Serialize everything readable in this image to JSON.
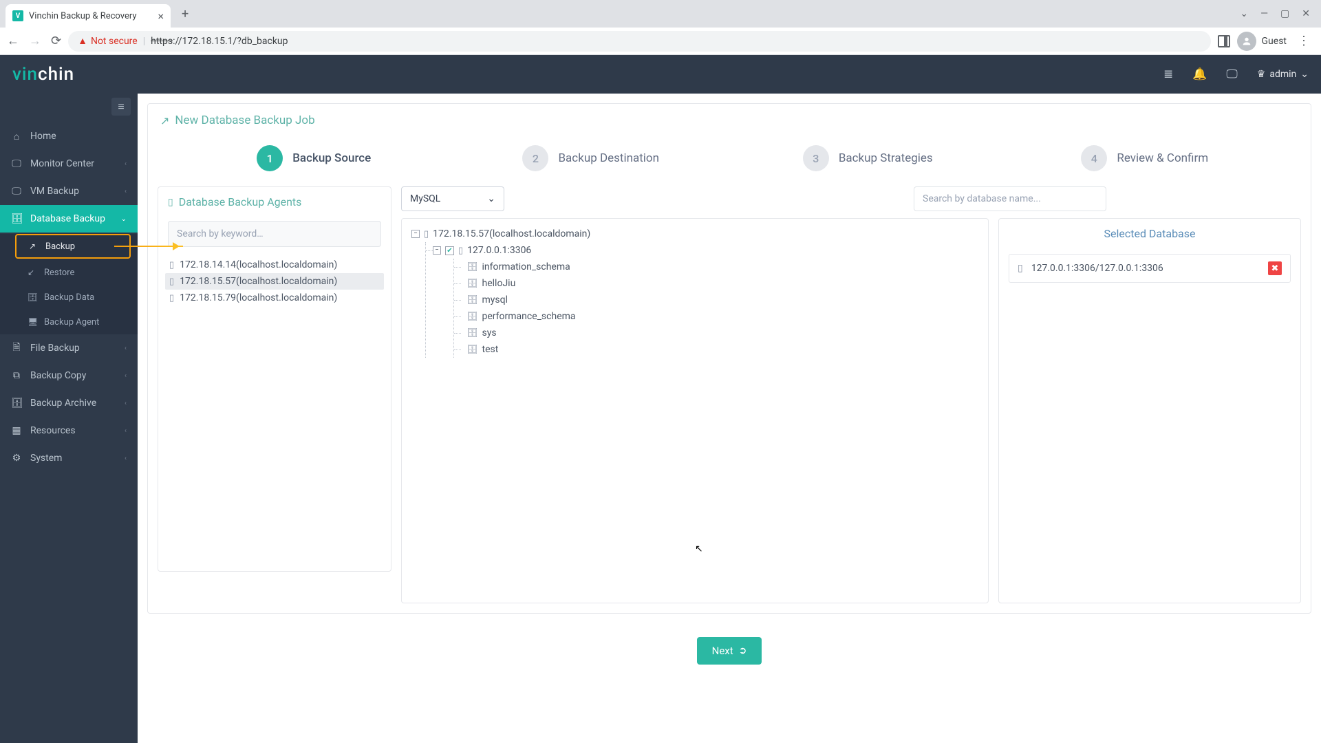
{
  "browser": {
    "tab_title": "Vinchin Backup & Recovery",
    "not_secure": "Not secure",
    "url_proto": "https",
    "url_rest": "://172.18.15.1/?db_backup",
    "guest": "Guest"
  },
  "header": {
    "user": "admin"
  },
  "sidebar": {
    "items": [
      {
        "label": "Home"
      },
      {
        "label": "Monitor Center"
      },
      {
        "label": "VM Backup"
      },
      {
        "label": "Database Backup"
      },
      {
        "label": "File Backup"
      },
      {
        "label": "Backup Copy"
      },
      {
        "label": "Backup Archive"
      },
      {
        "label": "Resources"
      },
      {
        "label": "System"
      }
    ],
    "submenu": [
      {
        "label": "Backup"
      },
      {
        "label": "Restore"
      },
      {
        "label": "Backup Data"
      },
      {
        "label": "Backup Agent"
      }
    ]
  },
  "page": {
    "title": "New Database Backup Job"
  },
  "steps": [
    {
      "num": "1",
      "label": "Backup Source"
    },
    {
      "num": "2",
      "label": "Backup Destination"
    },
    {
      "num": "3",
      "label": "Backup Strategies"
    },
    {
      "num": "4",
      "label": "Review & Confirm"
    }
  ],
  "agents": {
    "header": "Database Backup Agents",
    "search_placeholder": "Search by keyword…",
    "list": [
      "172.18.14.14(localhost.localdomain)",
      "172.18.15.57(localhost.localdomain)",
      "172.18.15.79(localhost.localdomain)"
    ]
  },
  "db_select": {
    "value": "MySQL"
  },
  "db_search_placeholder": "Search by database name...",
  "tree": {
    "server": "172.18.15.57(localhost.localdomain)",
    "instance": "127.0.0.1:3306",
    "databases": [
      "information_schema",
      "helloJiu",
      "mysql",
      "performance_schema",
      "sys",
      "test"
    ]
  },
  "selected": {
    "header": "Selected Database",
    "item": "127.0.0.1:3306/127.0.0.1:3306"
  },
  "buttons": {
    "next": "Next"
  }
}
